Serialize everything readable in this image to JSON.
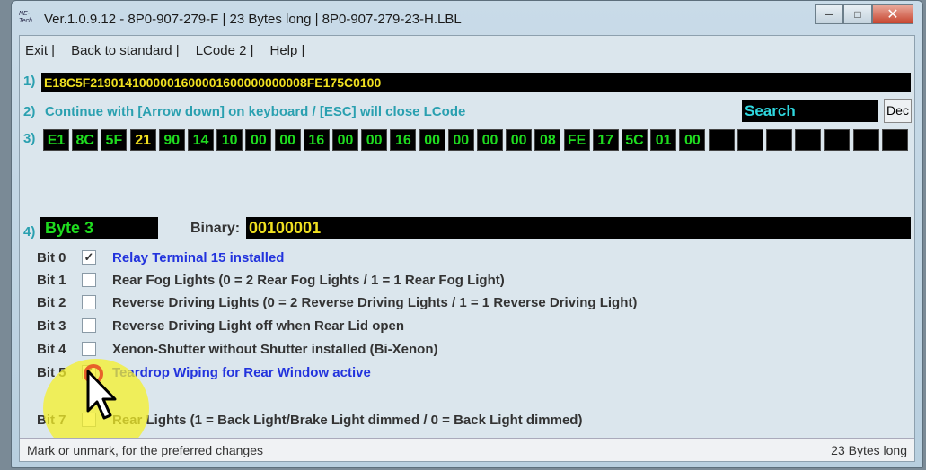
{
  "window": {
    "title": "Ver.1.0.9.12 -   8P0-907-279-F | 23 Bytes long | 8P0-907-279-23-H.LBL",
    "logo": "NE-Tech"
  },
  "menu": [
    "Exit |",
    "Back to standard |",
    "LCode 2 |",
    "Help |"
  ],
  "row1": {
    "label": "1)",
    "value": "E18C5F2190141000001600001600000000008FE175C0100"
  },
  "row2": {
    "label": "2)",
    "text": "Continue with [Arrow down] on keyboard / [ESC] will close LCode",
    "search_label": "Search",
    "dec_button": "Dec"
  },
  "row3": {
    "label": "3)",
    "bytes": [
      "E1",
      "8C",
      "5F",
      "21",
      "90",
      "14",
      "10",
      "00",
      "00",
      "16",
      "00",
      "00",
      "16",
      "00",
      "00",
      "00",
      "00",
      "08",
      "FE",
      "17",
      "5C",
      "01",
      "00",
      "",
      "",
      "",
      "",
      "",
      "",
      ""
    ],
    "selected_index": 3
  },
  "row4": {
    "label": "4)",
    "byte": "Byte 3",
    "binary_label": "Binary:",
    "binary": "00100001"
  },
  "bits": [
    {
      "name": "Bit 0",
      "text": "Relay Terminal 15 installed",
      "checked": true
    },
    {
      "name": "Bit 1",
      "text": "Rear Fog Lights (0 = 2 Rear Fog Lights / 1 = 1 Rear Fog Light)",
      "checked": false
    },
    {
      "name": "Bit 2",
      "text": "Reverse Driving Lights (0 = 2 Reverse Driving Lights / 1 = 1 Reverse Driving Light)",
      "checked": false
    },
    {
      "name": "Bit 3",
      "text": "Reverse Driving Light off when Rear Lid open",
      "checked": false
    },
    {
      "name": "Bit 4",
      "text": "Xenon-Shutter without Shutter installed (Bi-Xenon)",
      "checked": false
    },
    {
      "name": "Bit 5",
      "text": "Teardrop Wiping for Rear Window active",
      "checked": true
    },
    {
      "name": "Bit 7",
      "text": "Rear Lights (1 = Back Light/Brake Light dimmed / 0 = Back Light dimmed)",
      "checked": false
    }
  ],
  "status": {
    "left": "Mark or unmark, for the preferred changes",
    "right": "23 Bytes long"
  }
}
